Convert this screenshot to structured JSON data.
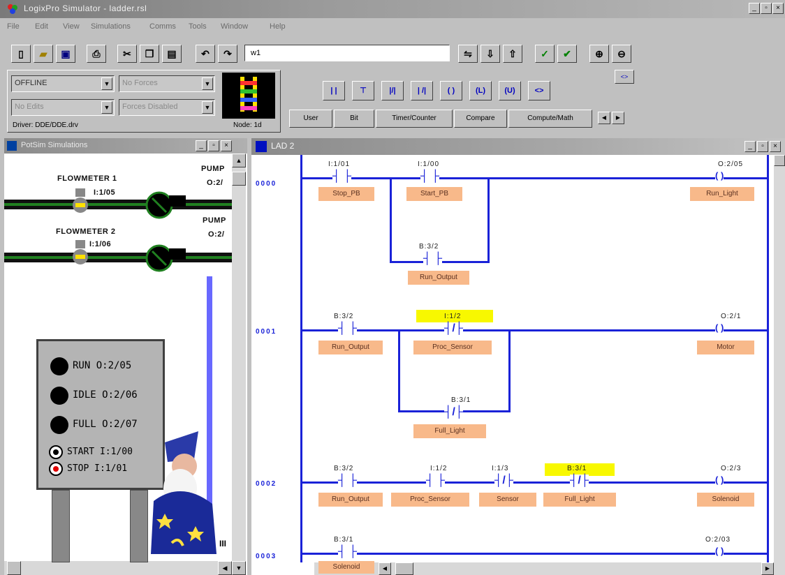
{
  "app": {
    "title": "LogixPro Simulator - ladder.rsl",
    "window_controls": [
      "_",
      "▫",
      "×"
    ]
  },
  "menu": [
    "File",
    "Edit",
    "View",
    "Simulations",
    "Comms",
    "Tools",
    "Window",
    "Help"
  ],
  "toolbar": {
    "address_value": "w1",
    "buttons": [
      "new",
      "open",
      "save",
      "print",
      "cut",
      "copy",
      "paste",
      "undo",
      "redo"
    ]
  },
  "status_panel": {
    "mode_select": "OFFLINE",
    "forces_select": "No Forces",
    "edits_select": "No Edits",
    "forces_state_select": "Forces Disabled",
    "driver_text": "Driver: DDE/DDE.drv",
    "node_text": "Node: 1d"
  },
  "instruction_buttons": [
    "| |",
    "⊤",
    "|/|",
    "| /|",
    "( )",
    "(L)",
    "(U)",
    "<>"
  ],
  "instruction_tabs": [
    "User",
    "Bit",
    "Timer/Counter",
    "Compare",
    "Compute/Math"
  ],
  "sim_window": {
    "title": "PotSim Simulations",
    "flowmeter1": {
      "label": "FLOWMETER 1",
      "addr": "I:1/05"
    },
    "flowmeter2": {
      "label": "FLOWMETER 2",
      "addr": "I:1/06"
    },
    "pump1": {
      "label": "PUMP",
      "addr": "O:2/"
    },
    "pump2": {
      "label": "PUMP",
      "addr": "O:2/"
    },
    "board": {
      "run": "RUN O:2/05",
      "idle": "IDLE O:2/06",
      "full": "FULL O:2/07",
      "start": "START I:1/00",
      "stop": "STOP I:1/01"
    },
    "corner_label": "III"
  },
  "lad_window": {
    "title": "LAD 2",
    "rungs": [
      {
        "num": "0000",
        "elements": [
          {
            "addr": "I:1/01",
            "tag": "Stop_PB"
          },
          {
            "addr": "I:1/00",
            "tag": "Start_PB"
          },
          {
            "addr": "B:3/2",
            "tag": "Run_Output"
          },
          {
            "addr": "O:2/05",
            "tag": "Run_Light"
          }
        ]
      },
      {
        "num": "0001",
        "elements": [
          {
            "addr": "B:3/2",
            "tag": "Run_Output"
          },
          {
            "addr": "I:1/2",
            "tag": "Proc_Sensor"
          },
          {
            "addr": "B:3/1",
            "tag": "Full_Light"
          },
          {
            "addr": "O:2/1",
            "tag": "Motor"
          }
        ]
      },
      {
        "num": "0002",
        "elements": [
          {
            "addr": "B:3/2",
            "tag": "Run_Output"
          },
          {
            "addr": "I:1/2",
            "tag": "Proc_Sensor"
          },
          {
            "addr": "I:1/3",
            "tag": "Sensor"
          },
          {
            "addr": "B:3/1",
            "tag": "Full_Light"
          },
          {
            "addr": "O:2/3",
            "tag": "Solenoid"
          }
        ]
      },
      {
        "num": "0003",
        "elements": [
          {
            "addr": "B:3/1",
            "tag": "Solenoid"
          },
          {
            "addr": "O:2/03",
            "tag": ""
          }
        ]
      }
    ]
  },
  "colors": {
    "rail_blue": "#1a22d8",
    "tag_orange": "#f8b98a",
    "highlight_yellow": "#f8f800",
    "pipe_green": "#208020"
  }
}
